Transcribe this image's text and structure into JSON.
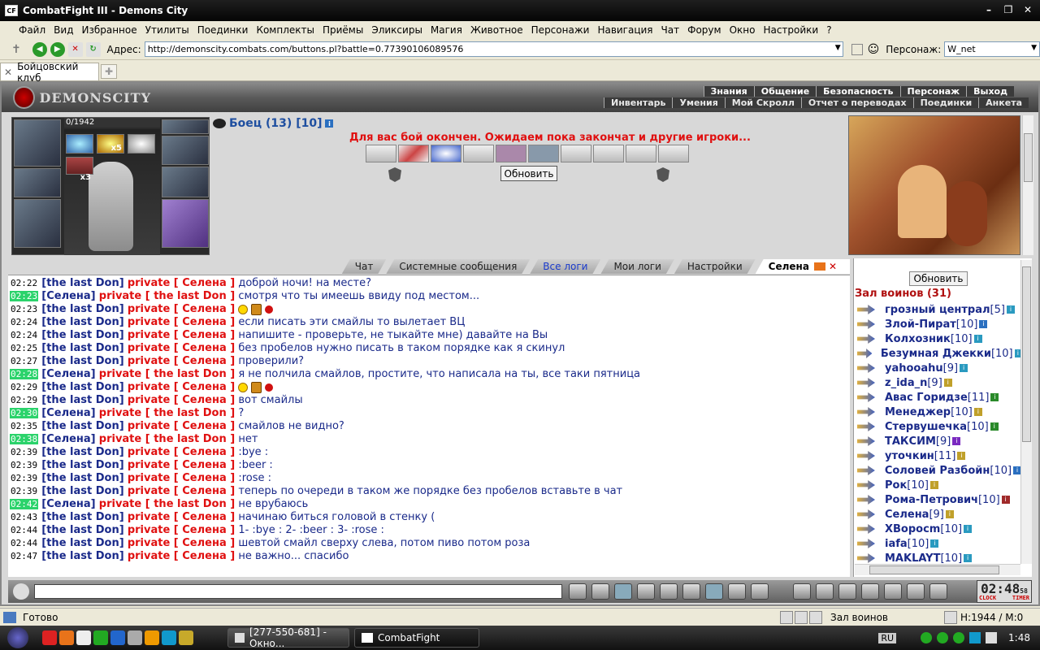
{
  "window": {
    "title": "CombatFight III - Demons City",
    "app_icon": "CF"
  },
  "menu": [
    "Файл",
    "Вид",
    "Избранное",
    "Утилиты",
    "Поединки",
    "Комплекты",
    "Приёмы",
    "Эликсиры",
    "Магия",
    "Животное",
    "Персонажи",
    "Навигация",
    "Чат",
    "Форум",
    "Окно",
    "Настройки",
    "?"
  ],
  "address": {
    "label": "Адрес:",
    "value": "http://demonscity.combats.com/buttons.pl?battle=0.77390106089576"
  },
  "persona": {
    "label": "Персонаж:",
    "value": "W_net"
  },
  "tab": {
    "label": "Бойцовский клуб"
  },
  "game": {
    "logo": "DEMONSCITY",
    "topnav1": [
      "Знания",
      "Общение",
      "Безопасность",
      "Персонаж",
      "Выход"
    ],
    "topnav2": [
      "Инвентарь",
      "Умения",
      "Мой Скролл",
      "Отчет о переводах",
      "Поединки",
      "Анкета"
    ],
    "hp": "0/1942",
    "stack1": "x5",
    "stack2": "x3",
    "fighter": "Боец (13) [10]",
    "battle_msg": "Для вас бой окончен. Ожидаем пока закончат и другие игроки...",
    "refresh": "Обновить"
  },
  "chat_tabs": [
    "Чат",
    "Системные сообщения",
    "Все логи",
    "Мои логи",
    "Настройки",
    "Селена"
  ],
  "chat": [
    {
      "t": "02:22",
      "hl": false,
      "from": "the last Don",
      "to": "Селена",
      "text": "доброй ночи! на месте?"
    },
    {
      "t": "02:23",
      "hl": true,
      "from": "Селена",
      "to": "the last Don",
      "text": "смотря что ты имеешь ввиду под местом..."
    },
    {
      "t": "02:23",
      "hl": false,
      "from": "the last Don",
      "to": "Селена",
      "text": "",
      "emo": true
    },
    {
      "t": "02:24",
      "hl": false,
      "from": "the last Don",
      "to": "Селена",
      "text": "если писать эти смайлы то вылетает ВЦ"
    },
    {
      "t": "02:24",
      "hl": false,
      "from": "the last Don",
      "to": "Селена",
      "text": "напишите - проверьте, не тыкайте мне) давайте на Вы"
    },
    {
      "t": "02:25",
      "hl": false,
      "from": "the last Don",
      "to": "Селена",
      "text": "без пробелов нужно писать в таком порядке как я скинул"
    },
    {
      "t": "02:27",
      "hl": false,
      "from": "the last Don",
      "to": "Селена",
      "text": "проверили?"
    },
    {
      "t": "02:28",
      "hl": true,
      "from": "Селена",
      "to": "the last Don",
      "text": "я не полчила смайлов, простите, что написала на ты, все таки пятница"
    },
    {
      "t": "02:29",
      "hl": false,
      "from": "the last Don",
      "to": "Селена",
      "text": "",
      "emo": true
    },
    {
      "t": "02:29",
      "hl": false,
      "from": "the last Don",
      "to": "Селена",
      "text": "вот смайлы"
    },
    {
      "t": "02:30",
      "hl": true,
      "from": "Селена",
      "to": "the last Don",
      "text": "?"
    },
    {
      "t": "02:35",
      "hl": false,
      "from": "the last Don",
      "to": "Селена",
      "text": "смайлов не видно?"
    },
    {
      "t": "02:38",
      "hl": true,
      "from": "Селена",
      "to": "the last Don",
      "text": "нет"
    },
    {
      "t": "02:39",
      "hl": false,
      "from": "the last Don",
      "to": "Селена",
      "text": ":bye :"
    },
    {
      "t": "02:39",
      "hl": false,
      "from": "the last Don",
      "to": "Селена",
      "text": ":beer :"
    },
    {
      "t": "02:39",
      "hl": false,
      "from": "the last Don",
      "to": "Селена",
      "text": ":rose :"
    },
    {
      "t": "02:39",
      "hl": false,
      "from": "the last Don",
      "to": "Селена",
      "text": "теперь по очереди в таком же порядке без пробелов вставьте в чат"
    },
    {
      "t": "02:42",
      "hl": true,
      "from": "Селена",
      "to": "the last Don",
      "text": "не врубаюсь"
    },
    {
      "t": "02:43",
      "hl": false,
      "from": "the last Don",
      "to": "Селена",
      "text": "начинаю биться головой в стенку ("
    },
    {
      "t": "02:44",
      "hl": false,
      "from": "the last Don",
      "to": "Селена",
      "text": "1- :bye : 2- :beer : 3- :rose :"
    },
    {
      "t": "02:44",
      "hl": false,
      "from": "the last Don",
      "to": "Селена",
      "text": "шевтой смайл сверху слева, потом пиво потом роза"
    },
    {
      "t": "02:47",
      "hl": false,
      "from": "the last Don",
      "to": "Селена",
      "text": "не важно... спасибо"
    }
  ],
  "private_word": "private",
  "hall": {
    "refresh": "Обновить",
    "title": "Зал воинов (31)",
    "players": [
      {
        "name": "грозный централ",
        "lv": "[5]"
      },
      {
        "name": "Злой-Пират",
        "lv": "[10]"
      },
      {
        "name": "Колхозник",
        "lv": "[10]"
      },
      {
        "name": "Безумная Джекки",
        "lv": "[10]"
      },
      {
        "name": "yahooahu",
        "lv": "[9]"
      },
      {
        "name": "z_ida_n",
        "lv": "[9]"
      },
      {
        "name": "Авас Горидзе",
        "lv": "[11]"
      },
      {
        "name": "Менеджер",
        "lv": "[10]"
      },
      {
        "name": "Стервушечка",
        "lv": "[10]"
      },
      {
        "name": "ТАКСИМ",
        "lv": "[9]"
      },
      {
        "name": "уточкин",
        "lv": "[11]"
      },
      {
        "name": "Соловей Разбойн",
        "lv": "[10]"
      },
      {
        "name": "Рок",
        "lv": "[10]"
      },
      {
        "name": "Рома-Петрович",
        "lv": "[10]"
      },
      {
        "name": "Селена",
        "lv": "[9]"
      },
      {
        "name": "ХВоросm",
        "lv": "[10]"
      },
      {
        "name": "iafa",
        "lv": "[10]"
      },
      {
        "name": "MAKLAYT",
        "lv": "[10]"
      }
    ]
  },
  "clock": {
    "time": "02:48",
    "sec": "58",
    "l1": "CLOCK",
    "l2": "TIMER"
  },
  "status": {
    "left": "Готово",
    "mid": "Зал воинов",
    "right": "H:1944 / M:0"
  },
  "taskbar": {
    "task1": "[277-550-681] - Окно...",
    "task2": "CombatFight",
    "lang": "RU",
    "time": "1:48"
  }
}
